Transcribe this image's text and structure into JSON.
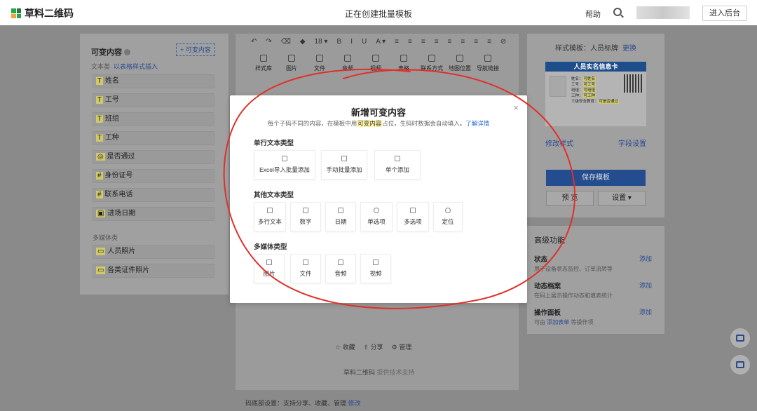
{
  "header": {
    "brand": "草料二维码",
    "title": "正在创建批量模板",
    "help": "帮助",
    "enter_admin": "进入后台"
  },
  "left_panel": {
    "title": "可变内容",
    "add_button": "+ 可变内容",
    "text_type_label": "文本类",
    "insert_link": "以表格样式插入",
    "text_fields": [
      "姓名",
      "工号",
      "班组",
      "工种",
      "是否通过",
      "身份证号",
      "联系电话",
      "进场日期"
    ],
    "media_label": "多媒体类",
    "media_fields": [
      "人员照片",
      "各类证件照片"
    ]
  },
  "editor": {
    "toolbar_top": [
      "↶",
      "↷",
      "⌫",
      "◆",
      "18 ▾",
      "B",
      "I",
      "U",
      "A ▾",
      "≡",
      "≡",
      "≡",
      "≡",
      "≡",
      "≡",
      "≡",
      "≡",
      "⊘"
    ],
    "toolbar_items": [
      "样式库",
      "图片",
      "文件",
      "音频",
      "视频",
      "表格",
      "联系方式",
      "地图位置",
      "导航链接"
    ],
    "footer_links": [
      "☆ 收藏",
      "⇧ 分享",
      "⚙ 管理"
    ],
    "footer_brand": "草料二维码",
    "footer_brand_sub": "提供技术支持",
    "bottom_note": "码底部设置：支持分享、收藏、管理",
    "bottom_note_link": "修改"
  },
  "right_panel": {
    "style_label": "样式模板：人员标牌",
    "style_change": "更换",
    "card": {
      "title": "人员实名信息卡",
      "rows": [
        {
          "label": "姓名：",
          "value": "可姓名"
        },
        {
          "label": "工号：",
          "value": "可工号"
        },
        {
          "label": "班组：",
          "value": "可班组"
        },
        {
          "label": "工种：",
          "value": "可工种"
        },
        {
          "label": "三级安全教育：",
          "value": "可是否通过"
        }
      ]
    },
    "modify_style": "修改样式",
    "field_settings": "字段设置",
    "save": "保存模板",
    "preview": "预 览",
    "settings": "设置 ▾"
  },
  "advanced": {
    "title": "高级功能",
    "items": [
      {
        "title": "状态",
        "desc": "用于设备状态监控、订单流转等",
        "add": "添加"
      },
      {
        "title": "动态档案",
        "desc": "在码上展示操作动态和填表统计",
        "add": "添加"
      },
      {
        "title": "操作面板",
        "desc_before": "可由",
        "desc_link": "添加表单",
        "desc_after": "等操作项",
        "add": "添加"
      }
    ]
  },
  "modal": {
    "title": "新增可变内容",
    "close": "×",
    "desc_before": "每个子码不同的内容，在模板中用",
    "desc_highlight": "可变内容",
    "desc_after": "占位，生码时数据会自动填入。",
    "desc_link": "了解详情",
    "groups": [
      {
        "title": "单行文本类型",
        "options": [
          "Excel导入批量添加",
          "手动批量添加",
          "单个添加"
        ]
      },
      {
        "title": "其他文本类型",
        "options": [
          "多行文本",
          "数字",
          "日期",
          "单选项",
          "多选项",
          "定位"
        ]
      },
      {
        "title": "多媒体类型",
        "options": [
          "图片",
          "文件",
          "音频",
          "视频"
        ]
      }
    ]
  },
  "colors": {
    "accent_blue": "#2a6bd3",
    "dark_blue": "#234d8f",
    "highlight": "#fff6a8",
    "annotation_red": "#e0302a"
  }
}
